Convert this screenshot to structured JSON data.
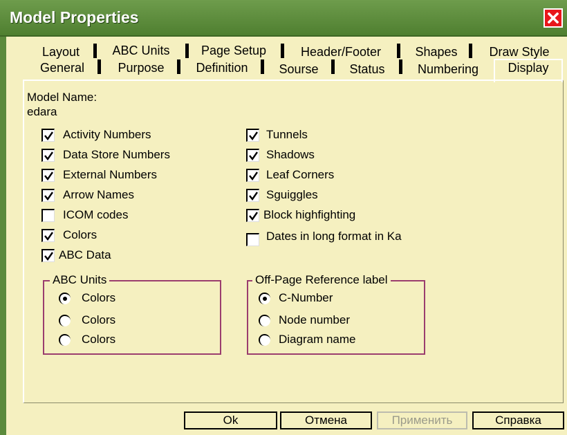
{
  "window": {
    "title": "Model Properties"
  },
  "tabs": {
    "row1": [
      "Layout",
      "ABC Units",
      "Page Setup",
      "Header/Footer",
      "Shapes",
      "Draw Style"
    ],
    "row2": [
      "General",
      "Purpose",
      "Definition",
      "Sourse",
      "Status",
      "Numbering"
    ],
    "active": "Display"
  },
  "display": {
    "model_name_label": "Model Name:",
    "model_name_value": "edara",
    "left_checks": [
      {
        "label": "Activity Numbers",
        "checked": true
      },
      {
        "label": "Data Store Numbers",
        "checked": true
      },
      {
        "label": "External Numbers",
        "checked": true
      },
      {
        "label": "Arrow Names",
        "checked": true
      },
      {
        "label": "ICOM codes",
        "checked": false
      },
      {
        "label": "Colors",
        "checked": true
      },
      {
        "label": "ABC Data",
        "checked": true
      }
    ],
    "right_checks": [
      {
        "label": "Tunnels",
        "checked": true
      },
      {
        "label": "Shadows",
        "checked": true
      },
      {
        "label": "Leaf Corners",
        "checked": true
      },
      {
        "label": "Sguiggles",
        "checked": true
      },
      {
        "label": "Block highfighting",
        "checked": true
      },
      {
        "label": "Dates in long format in Ka",
        "checked": false
      }
    ],
    "abc_units": {
      "title": "ABC Units",
      "options": [
        {
          "label": "Colors",
          "selected": true
        },
        {
          "label": "Colors",
          "selected": false
        },
        {
          "label": "Colors",
          "selected": false
        }
      ]
    },
    "off_page": {
      "title": "Off-Page Reference label",
      "options": [
        {
          "label": "C-Number",
          "selected": true
        },
        {
          "label": "Node number",
          "selected": false
        },
        {
          "label": "Diagram name",
          "selected": false
        }
      ]
    }
  },
  "buttons": {
    "ok": "Ok",
    "cancel": "Отмена",
    "apply": "Применить",
    "help": "Справка"
  },
  "colors": {
    "window_bg": "#f5f0c0",
    "title_bar": "#5b8a3c",
    "close": "#e8171c",
    "group_border": "#9a3d6e"
  }
}
